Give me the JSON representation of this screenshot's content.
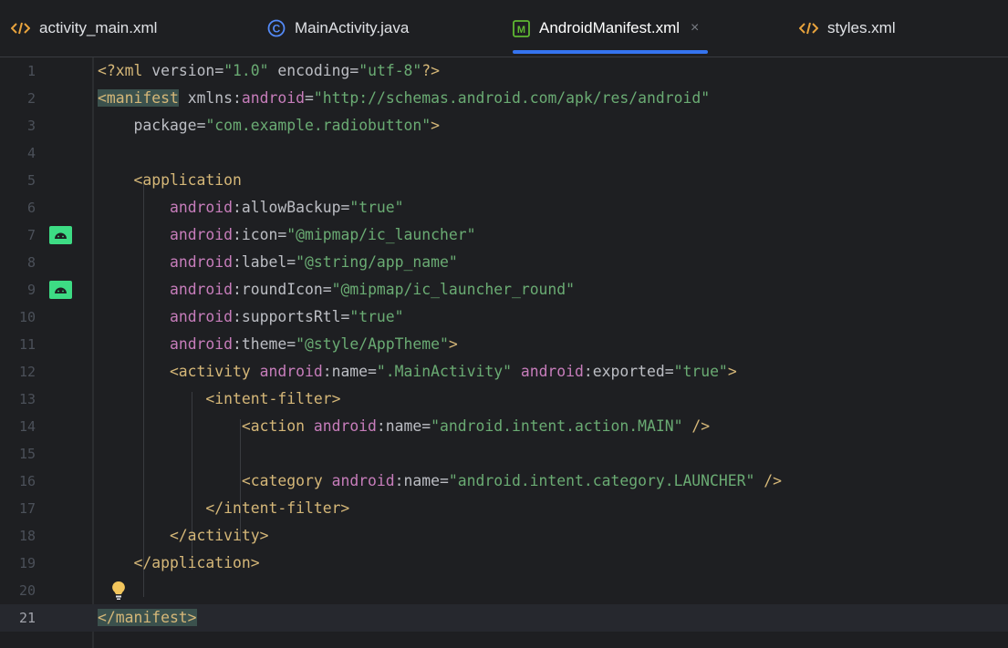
{
  "tabs": [
    {
      "label": "activity_main.xml",
      "icon": "xml-tag-icon"
    },
    {
      "label": "MainActivity.java",
      "icon": "java-class-icon"
    },
    {
      "label": "AndroidManifest.xml",
      "icon": "manifest-icon",
      "active": true,
      "close": "×"
    },
    {
      "label": "styles.xml",
      "icon": "xml-tag-icon"
    }
  ],
  "editor": {
    "current_line": "21",
    "lines": [
      {
        "n": "1"
      },
      {
        "n": "2"
      },
      {
        "n": "3"
      },
      {
        "n": "4"
      },
      {
        "n": "5"
      },
      {
        "n": "6"
      },
      {
        "n": "7"
      },
      {
        "n": "8"
      },
      {
        "n": "9"
      },
      {
        "n": "10"
      },
      {
        "n": "11"
      },
      {
        "n": "12"
      },
      {
        "n": "13"
      },
      {
        "n": "14"
      },
      {
        "n": "15"
      },
      {
        "n": "16"
      },
      {
        "n": "17"
      },
      {
        "n": "18"
      },
      {
        "n": "19"
      },
      {
        "n": "20"
      },
      {
        "n": "21"
      }
    ],
    "code": {
      "l1": {
        "a": "<?",
        "b": "xml",
        "c": " version",
        "d": "=",
        "e": "\"1.0\"",
        "f": " encoding",
        "g": "=",
        "h": "\"utf-8\"",
        "i": "?>"
      },
      "l2": {
        "a": "<",
        "b": "manifest",
        "c": " xmlns",
        "d": ":",
        "e": "android",
        "f": "=",
        "g": "\"http://schemas.android.com/apk/res/android\""
      },
      "l3": {
        "a": "    package",
        "b": "=",
        "c": "\"com.example.radiobutton\"",
        "d": ">"
      },
      "l5": {
        "a": "    <application"
      },
      "l6": {
        "a": "        ",
        "b": "android",
        "c": ":allowBackup",
        "d": "=",
        "e": "\"true\""
      },
      "l7": {
        "a": "        ",
        "b": "android",
        "c": ":icon",
        "d": "=",
        "e": "\"@mipmap/ic_launcher\""
      },
      "l8": {
        "a": "        ",
        "b": "android",
        "c": ":label",
        "d": "=",
        "e": "\"@string/app_name\""
      },
      "l9": {
        "a": "        ",
        "b": "android",
        "c": ":roundIcon",
        "d": "=",
        "e": "\"@mipmap/ic_launcher_round\""
      },
      "l10": {
        "a": "        ",
        "b": "android",
        "c": ":supportsRtl",
        "d": "=",
        "e": "\"true\""
      },
      "l11": {
        "a": "        ",
        "b": "android",
        "c": ":theme",
        "d": "=",
        "e": "\"@style/AppTheme\"",
        "f": ">"
      },
      "l12": {
        "a": "        <activity ",
        "b": "android",
        "c": ":name",
        "d": "=",
        "e": "\".MainActivity\"",
        "f": " ",
        "g": "android",
        "h": ":exported",
        "i": "=",
        "j": "\"true\"",
        "k": ">"
      },
      "l13": {
        "a": "            <intent-filter>"
      },
      "l14": {
        "a": "                <action ",
        "b": "android",
        "c": ":name",
        "d": "=",
        "e": "\"android.intent.action.MAIN\"",
        "f": " />"
      },
      "l16": {
        "a": "                <category ",
        "b": "android",
        "c": ":name",
        "d": "=",
        "e": "\"android.intent.category.LAUNCHER\"",
        "f": " />"
      },
      "l17": {
        "a": "            </intent-filter>"
      },
      "l18": {
        "a": "        </activity>"
      },
      "l19": {
        "a": "    </application>"
      },
      "l21": {
        "a": "</manifest>"
      }
    },
    "gutter_icons": [
      {
        "line": "7",
        "icon": "android-icon"
      },
      {
        "line": "9",
        "icon": "android-icon"
      }
    ],
    "lightbulb": {
      "line": "20",
      "icon": "lightbulb-icon"
    }
  }
}
